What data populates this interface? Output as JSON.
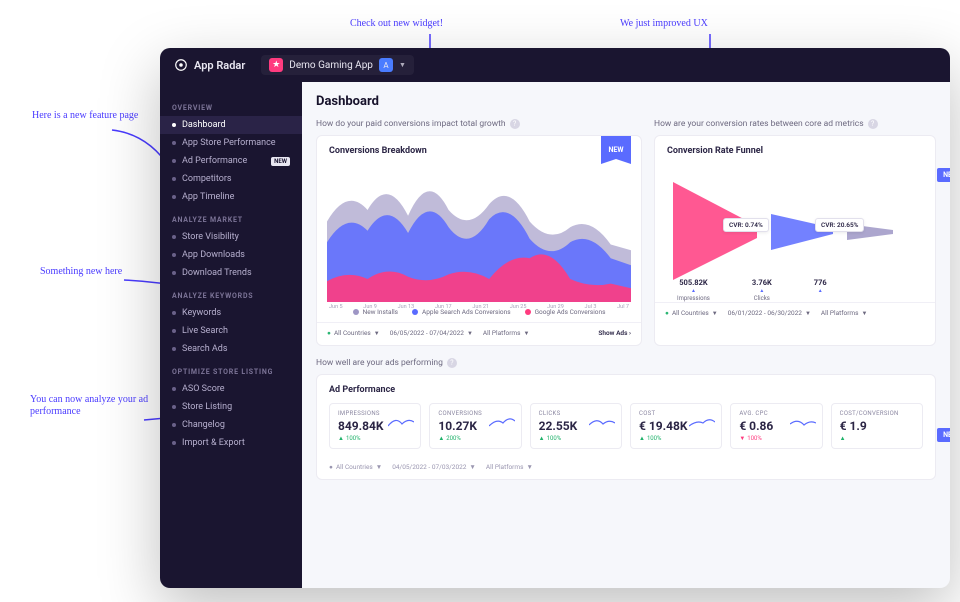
{
  "brand": "App Radar",
  "app_selector": {
    "name": "Demo Gaming App",
    "avatar_letter": "A"
  },
  "sidebar": {
    "sections": [
      {
        "title": "OVERVIEW",
        "items": [
          {
            "label": "Dashboard",
            "active": true
          },
          {
            "label": "App Store Performance"
          },
          {
            "label": "Ad Performance",
            "badge": "NEW"
          },
          {
            "label": "Competitors"
          },
          {
            "label": "App Timeline"
          }
        ]
      },
      {
        "title": "ANALYZE MARKET",
        "items": [
          {
            "label": "Store Visibility"
          },
          {
            "label": "App Downloads"
          },
          {
            "label": "Download Trends"
          }
        ]
      },
      {
        "title": "ANALYZE KEYWORDS",
        "items": [
          {
            "label": "Keywords"
          },
          {
            "label": "Live Search"
          },
          {
            "label": "Search Ads"
          }
        ]
      },
      {
        "title": "OPTIMIZE STORE LISTING",
        "items": [
          {
            "label": "ASO Score"
          },
          {
            "label": "Store Listing"
          },
          {
            "label": "Changelog"
          },
          {
            "label": "Import & Export"
          }
        ]
      }
    ]
  },
  "page_title": "Dashboard",
  "section1": {
    "question": "How do your paid conversions impact total growth",
    "card_title": "Conversions Breakdown",
    "ribbon": "NEW",
    "x_ticks": [
      "Jun 5",
      "Jun 9",
      "Jun 13",
      "Jun 17",
      "Jun 21",
      "Jun 25",
      "Jun 29",
      "Jul 3",
      "Jul 7"
    ],
    "legend": [
      {
        "label": "New Installs",
        "color": "#9e96c5"
      },
      {
        "label": "Apple Search Ads Conversions",
        "color": "#5a6bff"
      },
      {
        "label": "Google Ads Conversions",
        "color": "#ff3b7f"
      }
    ],
    "filters": {
      "countries": "All Countries",
      "dates": "06/05/2022 - 07/04/2022",
      "platforms": "All Platforms",
      "show_ads": "Show Ads"
    }
  },
  "section2": {
    "question": "How are your conversion rates between core ad metrics",
    "card_title": "Conversion Rate Funnel",
    "cvr": [
      {
        "label": "CVR: 0.74%"
      },
      {
        "label": "CVR: 20.65%"
      }
    ],
    "stages": [
      {
        "label": "Impressions",
        "value": "505.82K"
      },
      {
        "label": "Clicks",
        "value": "3.76K"
      },
      {
        "label": "",
        "value": "776"
      }
    ],
    "filters": {
      "countries": "All Countries",
      "dates": "06/01/2022 - 06/30/2022",
      "platforms": "All Platforms"
    }
  },
  "section3": {
    "question": "How well are your ads performing",
    "card_title": "Ad Performance",
    "kpis": [
      {
        "label": "IMPRESSIONS",
        "value": "849.84K",
        "delta": "100%",
        "dir": "up"
      },
      {
        "label": "CONVERSIONS",
        "value": "10.27K",
        "delta": "200%",
        "dir": "up"
      },
      {
        "label": "CLICKS",
        "value": "22.55K",
        "delta": "100%",
        "dir": "up"
      },
      {
        "label": "COST",
        "value": "€ 19.48K",
        "delta": "100%",
        "dir": "up"
      },
      {
        "label": "AVG. CPC",
        "value": "€ 0.86",
        "delta": "100%",
        "dir": "down"
      },
      {
        "label": "COST/CONVERSION",
        "value": "€ 1.9",
        "delta": "",
        "dir": "up"
      }
    ],
    "filters": {
      "countries": "All Countries",
      "dates": "04/05/2022 - 07/03/2022",
      "platforms": "All Platforms"
    }
  },
  "annotations": {
    "a1": "Here is a new feature page",
    "a2": "Check out new widget!",
    "a3": "We just improved UX",
    "a4": "Something new here",
    "a5": "You can now analyze your ad performance"
  },
  "chart_data": {
    "type": "area",
    "title": "Conversions Breakdown",
    "x": [
      "Jun 5",
      "Jun 9",
      "Jun 13",
      "Jun 17",
      "Jun 21",
      "Jun 25",
      "Jun 29",
      "Jul 3",
      "Jul 7"
    ],
    "series": [
      {
        "name": "New Installs",
        "color": "#9e96c5",
        "values": [
          55,
          75,
          50,
          68,
          40,
          60,
          35,
          42,
          30
        ]
      },
      {
        "name": "Apple Search Ads Conversions",
        "color": "#5a6bff",
        "values": [
          40,
          58,
          42,
          55,
          30,
          50,
          28,
          34,
          22
        ]
      },
      {
        "name": "Google Ads Conversions",
        "color": "#ff3b7f",
        "values": [
          12,
          18,
          14,
          20,
          10,
          22,
          28,
          14,
          10
        ]
      }
    ],
    "ylim": [
      0,
      80
    ]
  }
}
